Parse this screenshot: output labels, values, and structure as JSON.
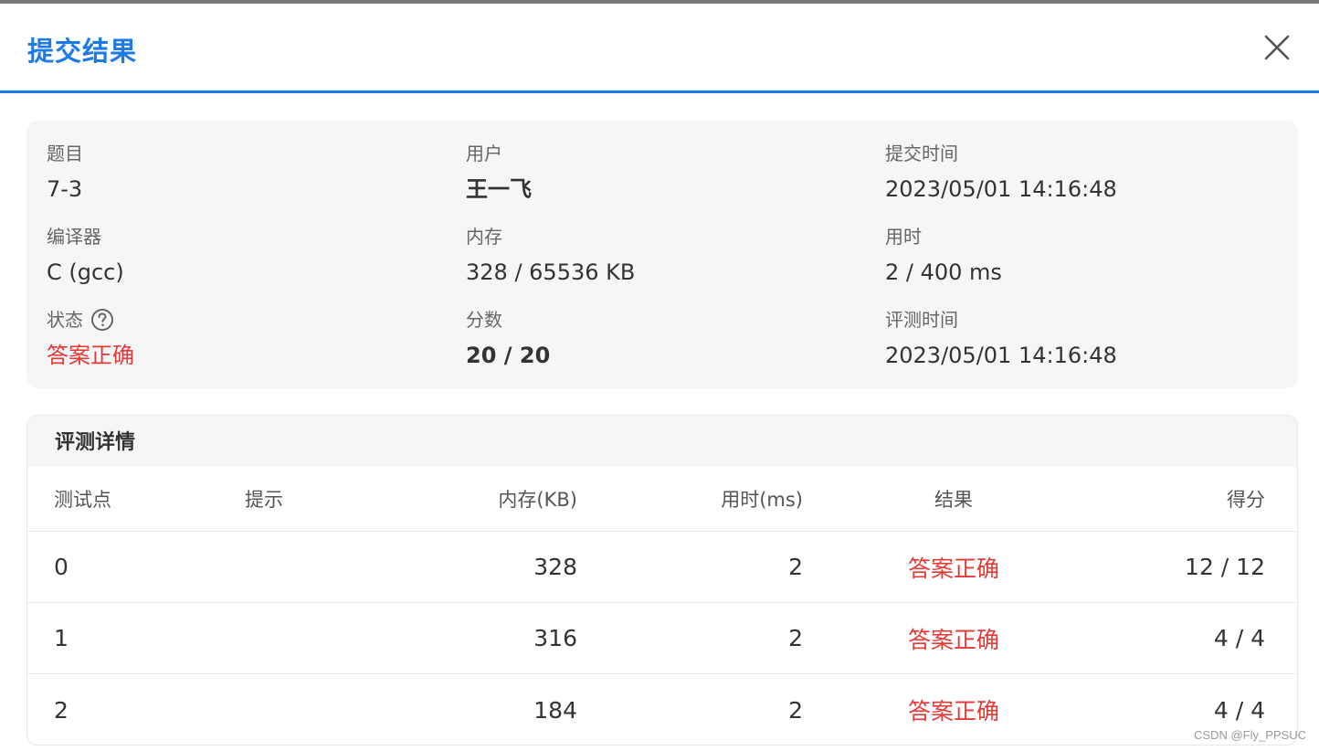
{
  "dialog": {
    "title": "提交结果"
  },
  "summary": {
    "problem": {
      "label": "题目",
      "value": "7-3"
    },
    "user": {
      "label": "用户",
      "value": "王一飞"
    },
    "submit_time": {
      "label": "提交时间",
      "value": "2023/05/01 14:16:48"
    },
    "compiler": {
      "label": "编译器",
      "value": "C (gcc)"
    },
    "memory": {
      "label": "内存",
      "value": "328 / 65536 KB"
    },
    "time_used": {
      "label": "用时",
      "value": "2 / 400 ms"
    },
    "status": {
      "label": "状态",
      "value": "答案正确",
      "help_icon": "question-circle-icon"
    },
    "score": {
      "label": "分数",
      "value": "20 / 20"
    },
    "judge_time": {
      "label": "评测时间",
      "value": "2023/05/01 14:16:48"
    }
  },
  "details": {
    "title": "评测详情",
    "columns": [
      "测试点",
      "提示",
      "内存(KB)",
      "用时(ms)",
      "结果",
      "得分"
    ],
    "rows": [
      {
        "case": "0",
        "hint": "",
        "memory": "328",
        "time": "2",
        "result": "答案正确",
        "score": "12 / 12"
      },
      {
        "case": "1",
        "hint": "",
        "memory": "316",
        "time": "2",
        "result": "答案正确",
        "score": "4 / 4"
      },
      {
        "case": "2",
        "hint": "",
        "memory": "184",
        "time": "2",
        "result": "答案正确",
        "score": "4 / 4"
      }
    ]
  },
  "watermark": "CSDN @Fly_PPSUC",
  "colors": {
    "accent": "#1e7be6",
    "success_text": "#e53935",
    "card_bg": "#f5f6f8"
  }
}
